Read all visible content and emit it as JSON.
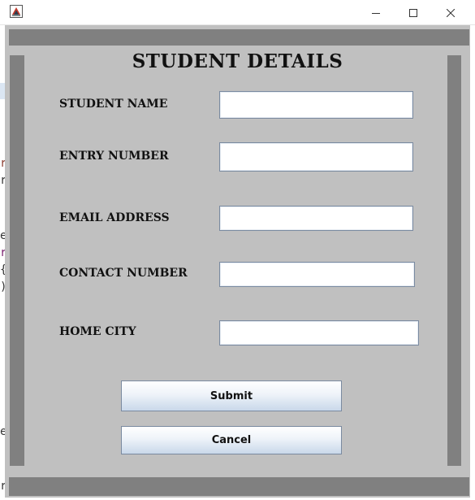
{
  "window": {
    "title": "",
    "controls": {
      "minimize_icon": "minimize-icon",
      "maximize_icon": "maximize-icon",
      "close_icon": "close-icon"
    }
  },
  "form": {
    "heading": "STUDENT DETAILS",
    "fields": [
      {
        "label": "STUDENT NAME",
        "value": ""
      },
      {
        "label": "ENTRY NUMBER",
        "value": ""
      },
      {
        "label": "EMAIL ADDRESS",
        "value": ""
      },
      {
        "label": "CONTACT NUMBER",
        "value": ""
      },
      {
        "label": "HOME CITY",
        "value": ""
      }
    ],
    "submit_label": "Submit",
    "cancel_label": "Cancel"
  },
  "background_editor": {
    "glyphs": [
      "r",
      "r",
      "e",
      "r",
      "{",
      ")",
      "e",
      "r"
    ]
  },
  "colors": {
    "panel": "#c0c0c0",
    "border_bar": "#808080",
    "button_gradient_top": "#ffffff",
    "button_gradient_bottom": "#c9d8ea"
  }
}
